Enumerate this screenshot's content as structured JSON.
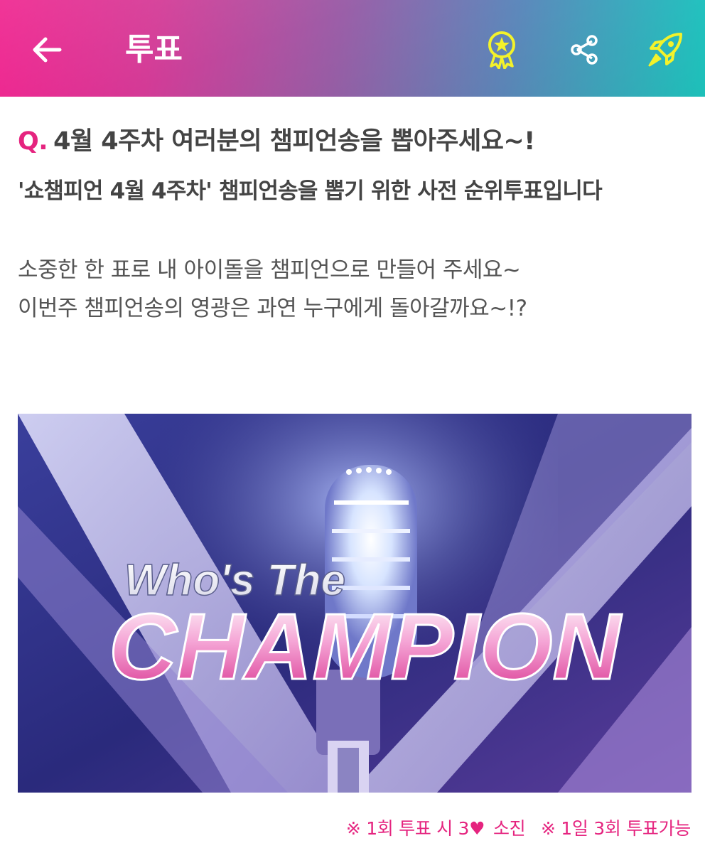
{
  "appbar": {
    "title": "투표",
    "icons": [
      "back-arrow-icon",
      "award-badge-icon",
      "share-icon",
      "rocket-icon"
    ],
    "colors": {
      "gradient_start": "#ef1f8c",
      "gradient_end": "#1fd0c8",
      "icon_accent": "#f3f22b"
    }
  },
  "question": {
    "prefix": "Q.",
    "text": "4월 4주차 여러분의 챔피언송을 뽑아주세요~!"
  },
  "subtitle": "'쇼챔피언 4월 4주차' 챔피언송을 뽑기 위한 사전 순위투표입니다",
  "description": {
    "line1": "소중한 한 표로 내 아이돌을 챔피언으로 만들어 주세요~",
    "line2": "이번주 챔피언송의 영광은 과연 누구에게 돌아갈까요~!?"
  },
  "banner": {
    "line1": "Who's The",
    "line2": "CHAMPION"
  },
  "footnote": {
    "part1": "※ 1회 투표 시 3",
    "heart": "♥",
    "part2": "소진",
    "part3": "※ 1일 3회 투표가능"
  },
  "colors": {
    "accent": "#e5247f",
    "text_dark": "#444444",
    "text_body": "#555555"
  }
}
